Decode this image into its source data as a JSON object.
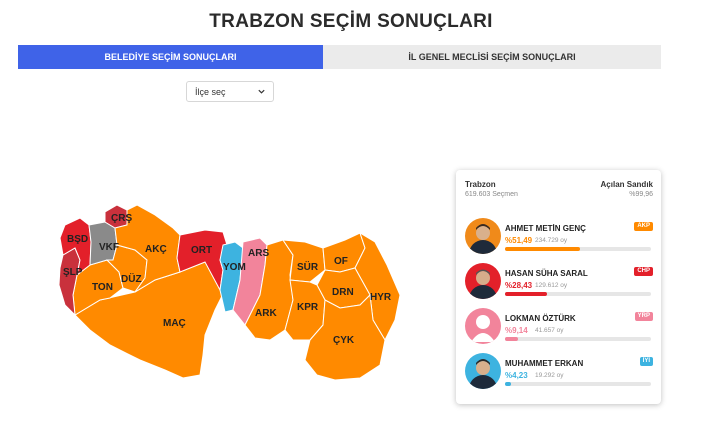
{
  "page": {
    "title": "TRABZON SEÇİM SONUÇLARI"
  },
  "tabs": [
    {
      "label": "BELEDİYE SEÇİM SONUÇLARI",
      "active": true
    },
    {
      "label": "İL GENEL MECLİSİ SEÇİM SONUÇLARI",
      "active": false
    }
  ],
  "district_select": {
    "value": "İlçe seç"
  },
  "colors": {
    "akp": "#ff8a00",
    "chp": "#e3202a",
    "yrp": "#f2849b",
    "iyi": "#3db3e0",
    "bbp": "#c9313c",
    "other": "#8a8a8a",
    "tab_active": "#3f63e8"
  },
  "map": {
    "districts": [
      {
        "label": "ÇRŞ",
        "party": "bbp"
      },
      {
        "label": "BŞD",
        "party": "chp"
      },
      {
        "label": "VKF",
        "party": "other"
      },
      {
        "label": "AKÇ",
        "party": "akp"
      },
      {
        "label": "ORT",
        "party": "chp"
      },
      {
        "label": "ARS",
        "party": "yrp"
      },
      {
        "label": "YOM",
        "party": "iyi"
      },
      {
        "label": "ŞLP",
        "party": "bbp"
      },
      {
        "label": "TON",
        "party": "akp"
      },
      {
        "label": "DÜZ",
        "party": "akp"
      },
      {
        "label": "SÜR",
        "party": "akp"
      },
      {
        "label": "OF",
        "party": "akp"
      },
      {
        "label": "DRN",
        "party": "akp"
      },
      {
        "label": "HYR",
        "party": "akp"
      },
      {
        "label": "KPR",
        "party": "akp"
      },
      {
        "label": "ARK",
        "party": "akp"
      },
      {
        "label": "MAÇ",
        "party": "akp"
      },
      {
        "label": "ÇYK",
        "party": "akp"
      }
    ]
  },
  "summary": {
    "city": "Trabzon",
    "voters": "619.603 Seçmen",
    "ballot_label": "Açılan Sandık",
    "ballot_value": "%99,96"
  },
  "candidates": [
    {
      "name": "AHMET METİN GENÇ",
      "party": "AKP",
      "percent": "%51,49",
      "votes": "234.729 oy",
      "share": 51.49,
      "color": "#ff8a00"
    },
    {
      "name": "HASAN SÜHA SARAL",
      "party": "CHP",
      "percent": "%28,43",
      "votes": "129.612 oy",
      "share": 28.43,
      "color": "#e3202a"
    },
    {
      "name": "LOKMAN ÖZTÜRK",
      "party": "YRP",
      "percent": "%9,14",
      "votes": "41.657 oy",
      "share": 9.14,
      "color": "#f2849b"
    },
    {
      "name": "MUHAMMET ERKAN",
      "party": "İYİ",
      "percent": "%4,23",
      "votes": "19.292 oy",
      "share": 4.23,
      "color": "#3db3e0"
    }
  ]
}
